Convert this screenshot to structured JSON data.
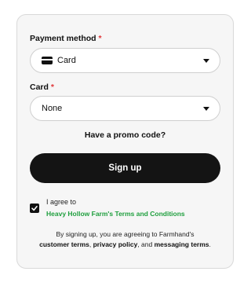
{
  "payment": {
    "label": "Payment method",
    "required_mark": "*",
    "selected": "Card",
    "icon": "credit-card-icon"
  },
  "card": {
    "label": "Card",
    "required_mark": "*",
    "selected": "None"
  },
  "promo": {
    "label": "Have a promo code?"
  },
  "signup": {
    "label": "Sign up"
  },
  "agree": {
    "checked": true,
    "text": "I agree to",
    "link": "Heavy Hollow Farm's Terms and Conditions"
  },
  "fine_print": {
    "prefix": "By signing up, you are agreeing to Farmhand's",
    "customer_terms": "customer terms",
    "sep1": ", ",
    "privacy_policy": "privacy policy",
    "sep2": ", and ",
    "messaging_terms": "messaging terms",
    "suffix": "."
  },
  "colors": {
    "required": "#e0373a",
    "link_green": "#1f9f3e",
    "button": "#141414"
  }
}
